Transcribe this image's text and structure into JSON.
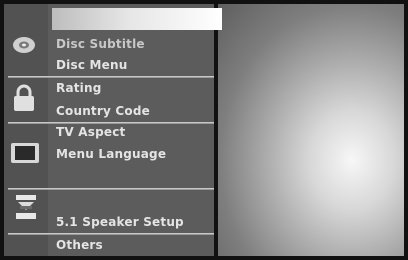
{
  "menu": {
    "title": "",
    "items": [
      {
        "label": "Disc Subtitle"
      },
      {
        "label": "Disc Menu"
      },
      {
        "label": "Rating"
      },
      {
        "label": "Country Code"
      },
      {
        "label": "TV Aspect"
      },
      {
        "label": "Menu Language"
      },
      {
        "label": "5.1 Speaker Setup"
      },
      {
        "label": "Others"
      }
    ]
  },
  "icons": {
    "disc": "disc-icon",
    "lock": "lock-icon",
    "tv": "tv-icon",
    "speaker": "speaker-icon"
  },
  "colors": {
    "panel": "#5c5c5c",
    "text": "#e4e4e4",
    "title_bar": "#ffffff"
  }
}
